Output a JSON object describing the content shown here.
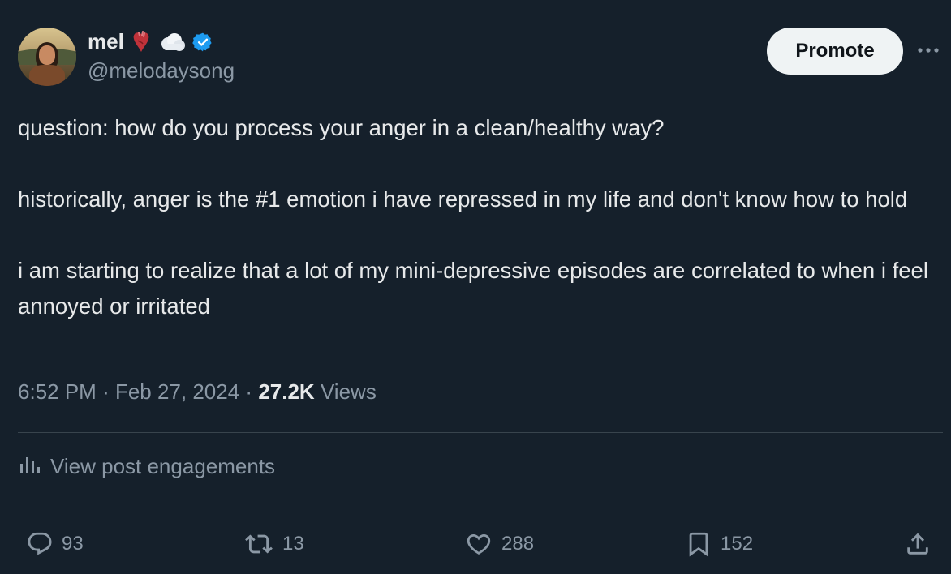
{
  "author": {
    "display_name": "mel",
    "handle": "@melodaysong",
    "badges": [
      "anatomical-heart-emoji",
      "cloud-emoji",
      "verified-badge-icon"
    ]
  },
  "header": {
    "promote_label": "Promote",
    "more_icon": "more-horizontal-icon"
  },
  "post": {
    "paragraphs": [
      "question: how do you process your anger in a clean/healthy way?",
      "historically, anger is the #1 emotion i have repressed in my life and don't know how to hold",
      "i am starting to realize that a lot of my mini-depressive episodes are correlated to when i feel annoyed or irritated"
    ],
    "time": "6:52 PM",
    "date": "Feb 27, 2024",
    "views_count": "27.2K",
    "views_label": "Views"
  },
  "engagements": {
    "label": "View post engagements",
    "icon": "analytics-icon"
  },
  "actions": {
    "replies": "93",
    "reposts": "13",
    "likes": "288",
    "bookmarks": "152"
  },
  "colors": {
    "background": "#15202b",
    "text": "#e7e9ea",
    "secondary": "#8b98a5",
    "verified": "#1d9bf0",
    "divider": "#38444d"
  }
}
